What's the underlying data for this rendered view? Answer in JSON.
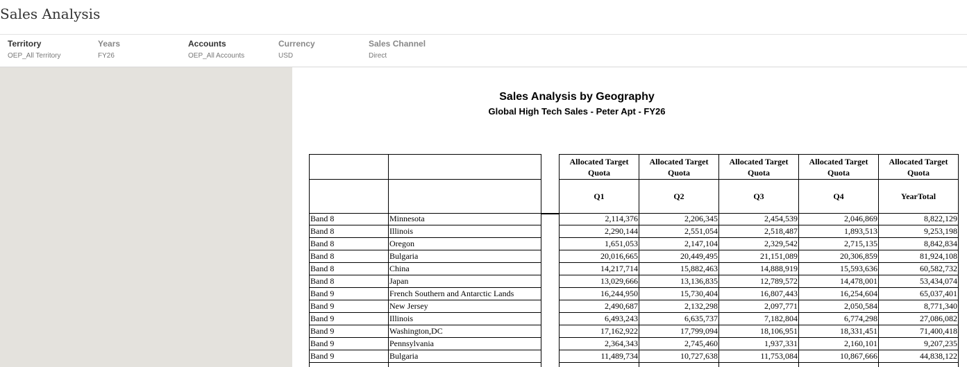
{
  "page": {
    "title": "Sales Analysis"
  },
  "pov": [
    {
      "label": "Territory",
      "value": "OEP_All Territory"
    },
    {
      "label": "Years",
      "value": "FY26"
    },
    {
      "label": "Accounts",
      "value": "OEP_All Accounts"
    },
    {
      "label": "Currency",
      "value": "USD"
    },
    {
      "label": "Sales Channel",
      "value": "Direct"
    }
  ],
  "report": {
    "title": "Sales Analysis by Geography",
    "subtitle": "Global High Tech Sales - Peter Apt - FY26",
    "measure_header": "Allocated Target Quota",
    "periods": [
      "Q1",
      "Q2",
      "Q3",
      "Q4",
      "YearTotal"
    ],
    "rows": [
      {
        "band": "Band 8",
        "geo": "Minnesota",
        "values": [
          "2,114,376",
          "2,206,345",
          "2,454,539",
          "2,046,869",
          "8,822,129"
        ]
      },
      {
        "band": "Band 8",
        "geo": "Illinois",
        "values": [
          "2,290,144",
          "2,551,054",
          "2,518,487",
          "1,893,513",
          "9,253,198"
        ]
      },
      {
        "band": "Band 8",
        "geo": "Oregon",
        "values": [
          "1,651,053",
          "2,147,104",
          "2,329,542",
          "2,715,135",
          "8,842,834"
        ]
      },
      {
        "band": "Band 8",
        "geo": "Bulgaria",
        "values": [
          "20,016,665",
          "20,449,495",
          "21,151,089",
          "20,306,859",
          "81,924,108"
        ]
      },
      {
        "band": "Band 8",
        "geo": "China",
        "values": [
          "14,217,714",
          "15,882,463",
          "14,888,919",
          "15,593,636",
          "60,582,732"
        ]
      },
      {
        "band": "Band 8",
        "geo": "Japan",
        "values": [
          "13,029,666",
          "13,136,835",
          "12,789,572",
          "14,478,001",
          "53,434,074"
        ]
      },
      {
        "band": "Band 9",
        "geo": "French Southern and Antarctic Lands",
        "values": [
          "16,244,950",
          "15,730,404",
          "16,807,443",
          "16,254,604",
          "65,037,401"
        ]
      },
      {
        "band": "Band 9",
        "geo": "New Jersey",
        "values": [
          "2,490,687",
          "2,132,298",
          "2,097,771",
          "2,050,584",
          "8,771,340"
        ]
      },
      {
        "band": "Band 9",
        "geo": "Illinois",
        "values": [
          "6,493,243",
          "6,635,737",
          "7,182,804",
          "6,774,298",
          "27,086,082"
        ]
      },
      {
        "band": "Band 9",
        "geo": "Washington,DC",
        "values": [
          "17,162,922",
          "17,799,094",
          "18,106,951",
          "18,331,451",
          "71,400,418"
        ]
      },
      {
        "band": "Band 9",
        "geo": "Pennsylvania",
        "values": [
          "2,364,343",
          "2,745,460",
          "1,937,331",
          "2,160,101",
          "9,207,235"
        ]
      },
      {
        "band": "Band 9",
        "geo": "Bulgaria",
        "values": [
          "11,489,734",
          "10,727,638",
          "11,753,084",
          "10,867,666",
          "44,838,122"
        ]
      }
    ]
  }
}
